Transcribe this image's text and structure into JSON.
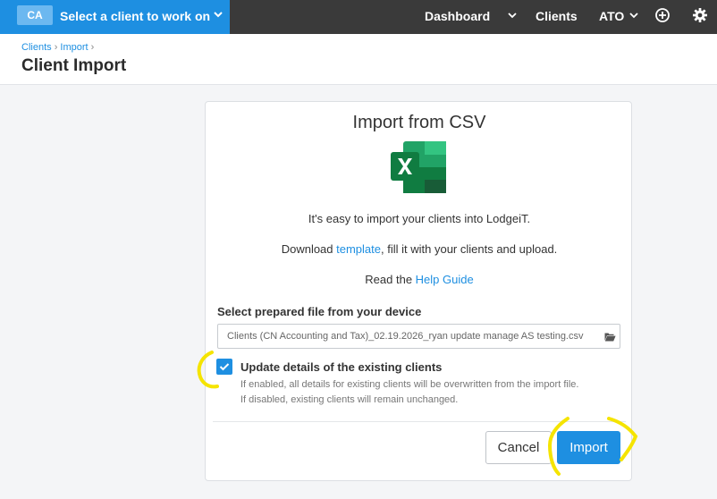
{
  "topbar": {
    "client_badge": "CA",
    "client_label": "Select a client to work on",
    "nav": {
      "dashboard": "Dashboard",
      "clients": "Clients",
      "ato": "ATO"
    }
  },
  "breadcrumb": {
    "items": [
      "Clients",
      "Import"
    ],
    "separator": "›"
  },
  "page_title": "Client Import",
  "card": {
    "title": "Import from CSV",
    "intro_line1": "It's easy to import your clients into LodgeiT.",
    "download_prefix": "Download ",
    "download_link": "template",
    "download_suffix": ", fill it with your clients and upload.",
    "read_prefix": "Read the ",
    "read_link": "Help Guide",
    "file_label": "Select prepared file from your device",
    "file_value": "Clients (CN Accounting and Tax)_02.19.2026_ryan update manage AS testing.csv",
    "update_label": "Update details of the existing clients",
    "update_checked": true,
    "help_line1": "If enabled, all details for existing clients will be overwritten from the import file.",
    "help_line2": "If disabled, existing clients will remain unchanged.",
    "cancel_label": "Cancel",
    "import_label": "Import"
  },
  "colors": {
    "accent": "#1e8fe1",
    "topbar": "#3a3a3a",
    "highlight": "#f5e400"
  }
}
